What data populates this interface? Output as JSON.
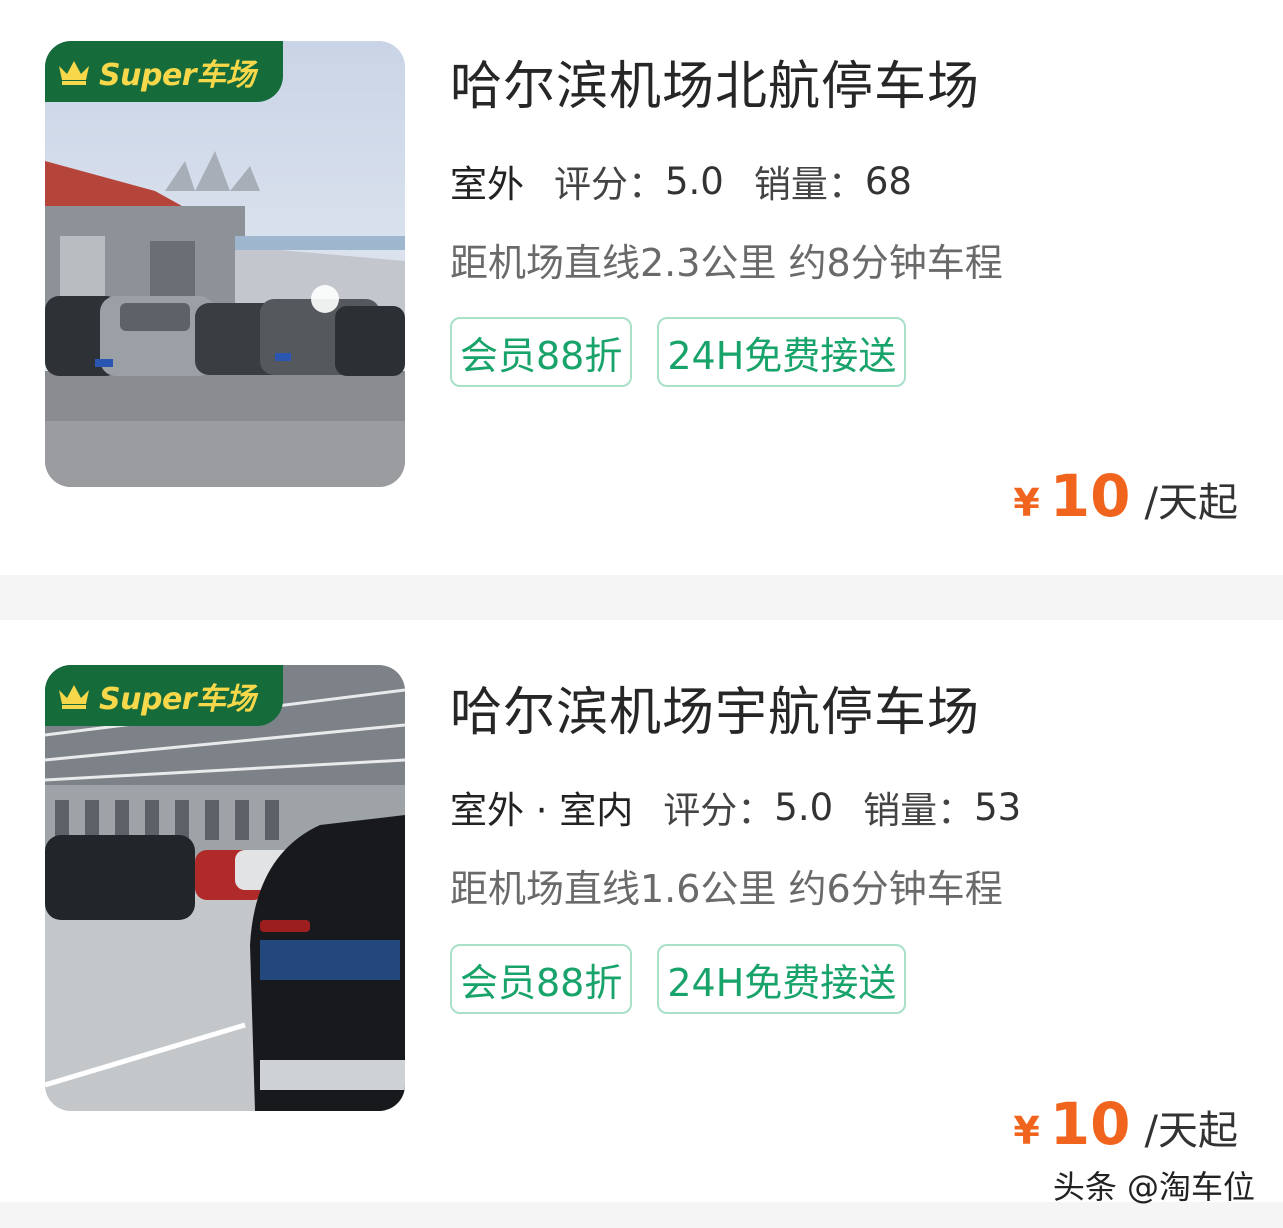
{
  "listings": [
    {
      "badge": "Super车场",
      "title": "哈尔滨机场北航停车场",
      "environment": "室外",
      "rating_label": "评分：",
      "rating": "5.0",
      "sales_label": "销量：",
      "sales": "68",
      "distance": "距机场直线2.3公里 约8分钟车程",
      "tags": [
        "会员88折",
        "24H免费接送"
      ],
      "price_symbol": "¥",
      "price": "10",
      "price_unit": "/天起"
    },
    {
      "badge": "Super车场",
      "title": "哈尔滨机场宇航停车场",
      "environment": "室外 · 室内",
      "rating_label": "评分：",
      "rating": "5.0",
      "sales_label": "销量：",
      "sales": "53",
      "distance": "距机场直线1.6公里 约6分钟车程",
      "tags": [
        "会员88折",
        "24H免费接送"
      ],
      "price_symbol": "¥",
      "price": "10",
      "price_unit": "/天起"
    }
  ],
  "watermark": "头条 @淘车位",
  "colors": {
    "badge_bg": "#166b3b",
    "badge_text": "#f6d84a",
    "tag_green": "#17a36a",
    "price_orange": "#f0641e"
  },
  "icons": [
    "crown-icon"
  ]
}
